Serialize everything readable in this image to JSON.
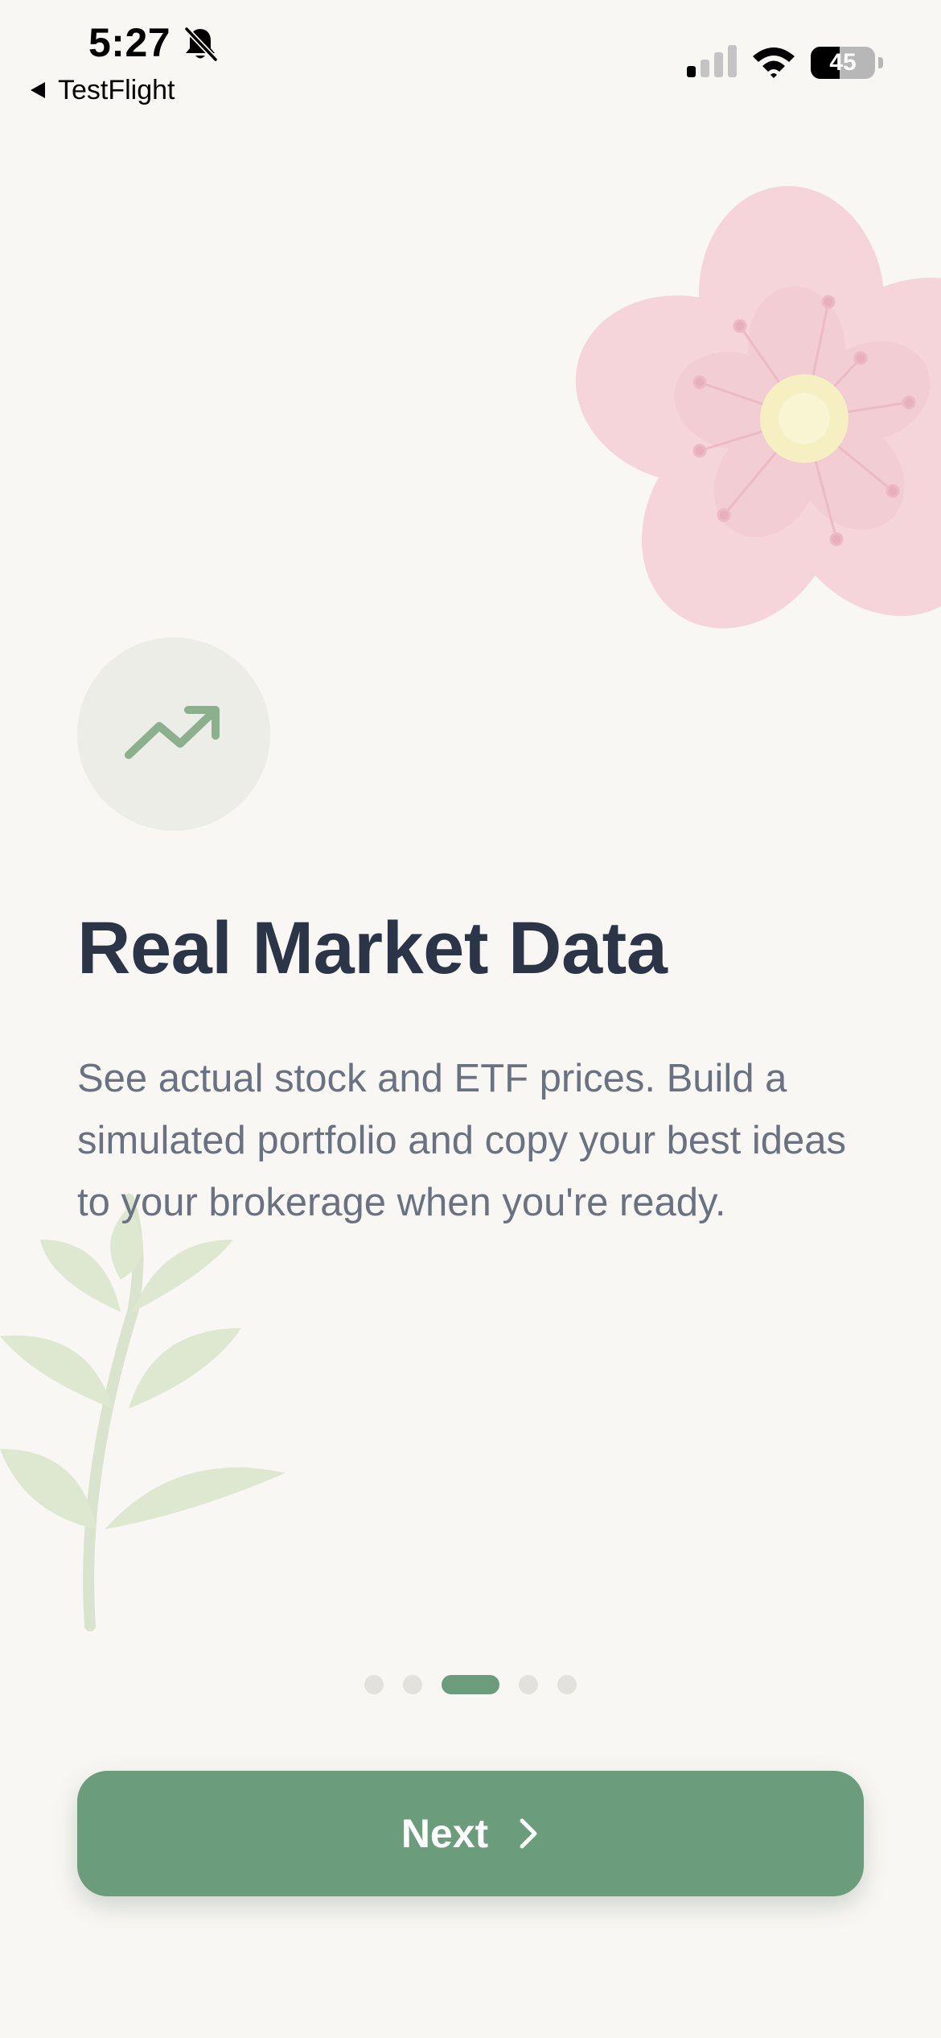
{
  "status_bar": {
    "time": "5:27",
    "back_label": "TestFlight",
    "battery_level": "45",
    "battery_fraction": 0.45,
    "signal_bars_active": 1,
    "signal_bars_total": 4
  },
  "onboarding": {
    "title": "Real Market Data",
    "body": "See actual stock and ETF prices. Build a simulated portfolio and copy your best ideas to your brokerage when you're ready.",
    "feature_icon": "trending-up-icon",
    "page_count": 5,
    "current_page": 3
  },
  "next_button": {
    "label": "Next",
    "icon": "chevron-right-icon"
  },
  "colors": {
    "accent": "#6b9c7c",
    "title": "#2b3547",
    "body_text": "#6a7282",
    "background": "#f9f7f3"
  }
}
